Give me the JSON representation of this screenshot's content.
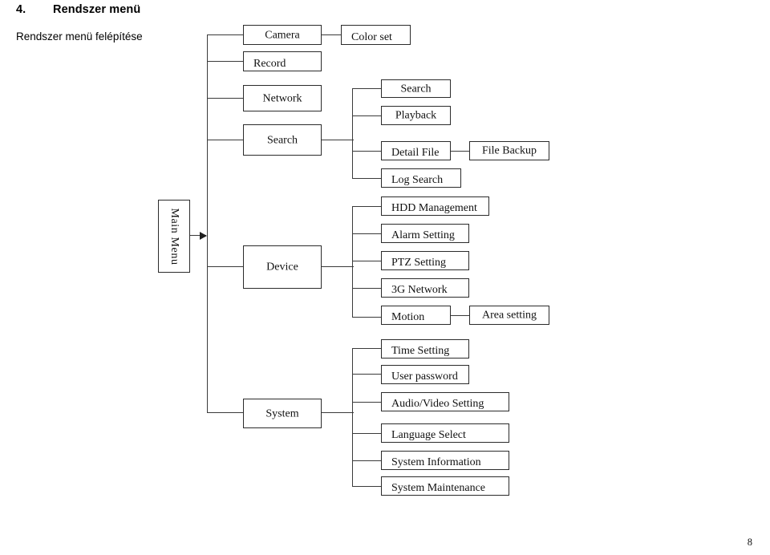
{
  "document": {
    "heading_number": "4.",
    "heading_title": "Rendszer menü",
    "subheading": "Rendszer menü felépítése",
    "page_number": "8"
  },
  "diagram": {
    "type": "tree",
    "root": {
      "label": "Main Menu",
      "orientation": "vertical"
    },
    "level1": [
      {
        "label": "Camera"
      },
      {
        "label": "Record"
      },
      {
        "label": "Network"
      },
      {
        "label": "Search"
      },
      {
        "label": "Device"
      },
      {
        "label": "System"
      }
    ],
    "camera_children": [
      {
        "label": "Color set"
      }
    ],
    "search_children": [
      {
        "label": "Search"
      },
      {
        "label": "Playback"
      },
      {
        "label": "Detail File"
      },
      {
        "label": "Log Search"
      }
    ],
    "detail_file_children": [
      {
        "label": "File Backup"
      }
    ],
    "device_children": [
      {
        "label": "HDD Management"
      },
      {
        "label": "Alarm Setting"
      },
      {
        "label": "PTZ Setting"
      },
      {
        "label": "3G Network"
      },
      {
        "label": "Motion"
      }
    ],
    "motion_children": [
      {
        "label": "Area setting"
      }
    ],
    "system_children": [
      {
        "label": "Time Setting"
      },
      {
        "label": "User password"
      },
      {
        "label": "Audio/Video Setting"
      },
      {
        "label": "Language Select"
      },
      {
        "label": "System Information"
      },
      {
        "label": "System Maintenance"
      }
    ],
    "colors": {
      "box_border": "#2b2b2b",
      "connector": "#3a3a3a",
      "background": "#ffffff",
      "text": "#111111"
    }
  }
}
